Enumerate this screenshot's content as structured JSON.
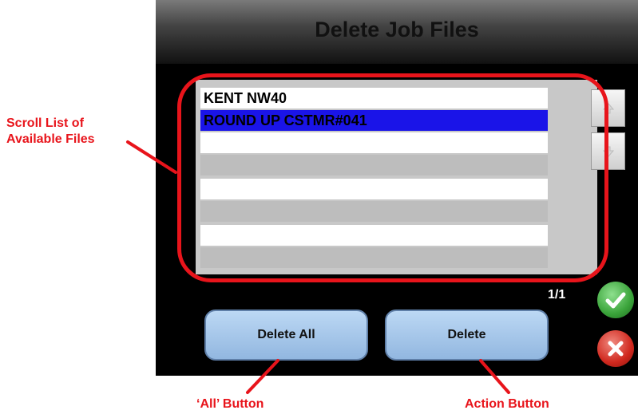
{
  "dialog": {
    "title": "Delete Job Files",
    "page_indicator": "1/1"
  },
  "file_list": {
    "rows": [
      {
        "label": "KENT NW40",
        "state": "normal"
      },
      {
        "label": "ROUND UP CSTMR#041",
        "state": "selected"
      },
      {
        "label": "",
        "state": "normal"
      },
      {
        "label": "",
        "state": "normal"
      },
      {
        "label": "",
        "state": "normal"
      },
      {
        "label": "",
        "state": "normal"
      },
      {
        "label": "",
        "state": "normal"
      },
      {
        "label": "",
        "state": "normal"
      }
    ],
    "scroll_up_icon": "arrow-up-icon",
    "scroll_down_icon": "arrow-down-icon"
  },
  "buttons": {
    "delete_all": "Delete All",
    "delete": "Delete",
    "accept_icon": "checkmark-icon",
    "cancel_icon": "close-icon"
  },
  "annotations": {
    "scroll_list": [
      "Scroll List of",
      "Available Files"
    ],
    "all_button": "‘All’ Button",
    "action_button": "Action Button"
  },
  "colors": {
    "annotation": "#e8141b",
    "selection": "#1a14e8",
    "accept": "#3aa33a",
    "cancel": "#d0281e"
  }
}
